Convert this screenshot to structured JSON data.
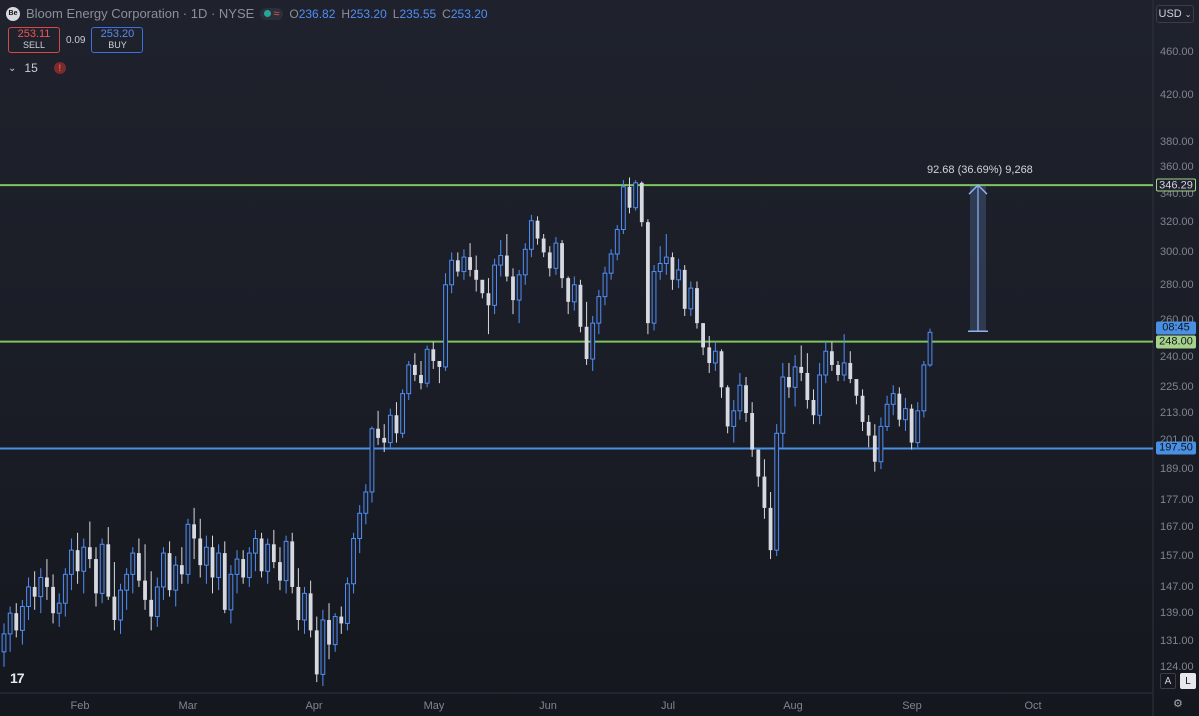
{
  "header": {
    "symbol_badge": "Be",
    "title": "Bloom Energy Corporation · 1D · NYSE",
    "ohlc": {
      "o_label": "O",
      "o": "236.82",
      "h_label": "H",
      "h": "253.20",
      "l_label": "L",
      "l": "235.55",
      "c_label": "C",
      "c": "253.20"
    },
    "sell_price": "253.11",
    "sell_label": "SELL",
    "spread": "0.09",
    "buy_price": "253.20",
    "buy_label": "BUY",
    "indicator_count": "15",
    "warning": "!"
  },
  "toolbar": {
    "currency": "USD",
    "auto_label": "A",
    "log_label": "L"
  },
  "measure_text": "92.68 (36.69%) 9,268",
  "colors": {
    "up": "#4f8ef7",
    "down": "#d7d9e0",
    "green_line": "#7ec45f",
    "blue_line": "#4a90e2"
  },
  "chart_data": {
    "type": "candlestick",
    "symbol": "Bloom Energy Corporation",
    "interval": "1D",
    "exchange": "NYSE",
    "y_scale": "log",
    "ylim": [
      118,
      480
    ],
    "y_ticks": [
      "460.00",
      "420.00",
      "380.00",
      "360.00",
      "340.00",
      "320.00",
      "300.00",
      "280.00",
      "260.00",
      "240.00",
      "225.00",
      "213.00",
      "201.00",
      "189.00",
      "177.00",
      "167.00",
      "157.00",
      "147.00",
      "139.00",
      "131.00",
      "124.00"
    ],
    "x_ticks": [
      "Feb",
      "Mar",
      "Apr",
      "May",
      "Jun",
      "Jul",
      "Aug",
      "Sep",
      "Oct"
    ],
    "horizontal_lines": [
      {
        "price": 346.29,
        "label": "346.29",
        "color": "green"
      },
      {
        "price": 248.0,
        "label": "248.00",
        "color": "green"
      },
      {
        "price": 197.5,
        "label": "197.50",
        "color": "blue"
      }
    ],
    "countdown": "08:45",
    "measure": {
      "from": 253.61,
      "to": 346.29,
      "text": "92.68 (36.69%) 9,268"
    },
    "candles": [
      [
        128,
        136,
        124,
        133
      ],
      [
        133,
        141,
        128,
        139
      ],
      [
        139,
        142,
        132,
        134
      ],
      [
        134,
        143,
        130,
        141
      ],
      [
        141,
        150,
        137,
        147
      ],
      [
        147,
        152,
        140,
        144
      ],
      [
        144,
        153,
        139,
        150
      ],
      [
        150,
        156,
        143,
        147
      ],
      [
        147,
        151,
        136,
        139
      ],
      [
        139,
        145,
        135,
        142
      ],
      [
        142,
        153,
        138,
        151
      ],
      [
        151,
        163,
        146,
        159
      ],
      [
        159,
        165,
        148,
        152
      ],
      [
        152,
        163,
        145,
        160
      ],
      [
        160,
        169,
        153,
        156
      ],
      [
        156,
        160,
        141,
        145
      ],
      [
        145,
        163,
        142,
        161
      ],
      [
        161,
        167,
        143,
        144
      ],
      [
        144,
        155,
        134,
        137
      ],
      [
        137,
        148,
        133,
        146
      ],
      [
        146,
        153,
        140,
        151
      ],
      [
        151,
        160,
        145,
        158
      ],
      [
        158,
        163,
        147,
        149
      ],
      [
        149,
        161,
        140,
        143
      ],
      [
        143,
        152,
        134,
        138
      ],
      [
        138,
        150,
        135,
        147
      ],
      [
        147,
        160,
        143,
        158
      ],
      [
        158,
        162,
        144,
        146
      ],
      [
        146,
        157,
        141,
        154
      ],
      [
        154,
        160,
        148,
        151
      ],
      [
        151,
        170,
        148,
        168
      ],
      [
        168,
        174,
        156,
        163
      ],
      [
        163,
        170,
        150,
        154
      ],
      [
        154,
        164,
        148,
        160
      ],
      [
        160,
        164,
        145,
        150
      ],
      [
        150,
        161,
        146,
        158
      ],
      [
        158,
        162,
        139,
        140
      ],
      [
        140,
        154,
        136,
        151
      ],
      [
        151,
        159,
        145,
        156
      ],
      [
        156,
        159,
        148,
        150
      ],
      [
        150,
        160,
        147,
        158
      ],
      [
        158,
        166,
        152,
        163
      ],
      [
        163,
        165,
        150,
        152
      ],
      [
        152,
        163,
        148,
        161
      ],
      [
        161,
        166,
        153,
        155
      ],
      [
        155,
        160,
        146,
        149
      ],
      [
        149,
        164,
        145,
        162
      ],
      [
        162,
        165,
        145,
        147
      ],
      [
        147,
        153,
        134,
        137
      ],
      [
        137,
        147,
        133,
        145
      ],
      [
        145,
        149,
        132,
        134
      ],
      [
        134,
        138,
        120,
        122
      ],
      [
        122,
        140,
        119,
        137
      ],
      [
        137,
        142,
        126,
        130
      ],
      [
        130,
        139,
        128,
        138
      ],
      [
        138,
        141,
        133,
        136
      ],
      [
        136,
        150,
        134,
        148
      ],
      [
        148,
        165,
        145,
        163
      ],
      [
        163,
        175,
        158,
        172
      ],
      [
        172,
        183,
        168,
        180
      ],
      [
        180,
        207,
        176,
        206
      ],
      [
        206,
        214,
        199,
        202
      ],
      [
        202,
        208,
        196,
        200
      ],
      [
        200,
        215,
        198,
        212
      ],
      [
        212,
        218,
        200,
        204
      ],
      [
        204,
        224,
        202,
        222
      ],
      [
        222,
        238,
        219,
        236
      ],
      [
        236,
        242,
        228,
        231
      ],
      [
        231,
        238,
        224,
        227
      ],
      [
        227,
        246,
        225,
        244
      ],
      [
        244,
        248,
        234,
        238
      ],
      [
        238,
        237,
        227,
        235
      ],
      [
        235,
        287,
        233,
        280
      ],
      [
        280,
        300,
        275,
        295
      ],
      [
        295,
        300,
        285,
        288
      ],
      [
        288,
        302,
        283,
        297
      ],
      [
        297,
        306,
        285,
        289
      ],
      [
        289,
        298,
        276,
        283
      ],
      [
        283,
        282,
        272,
        275
      ],
      [
        275,
        284,
        252,
        268
      ],
      [
        268,
        296,
        263,
        292
      ],
      [
        292,
        308,
        285,
        298
      ],
      [
        298,
        312,
        282,
        285
      ],
      [
        285,
        290,
        263,
        271
      ],
      [
        271,
        289,
        258,
        286
      ],
      [
        286,
        306,
        280,
        302
      ],
      [
        302,
        325,
        297,
        321
      ],
      [
        321,
        324,
        305,
        309
      ],
      [
        309,
        312,
        297,
        300
      ],
      [
        300,
        304,
        285,
        290
      ],
      [
        290,
        310,
        286,
        306
      ],
      [
        306,
        308,
        278,
        284
      ],
      [
        284,
        285,
        263,
        270
      ],
      [
        270,
        285,
        265,
        280
      ],
      [
        280,
        283,
        253,
        256
      ],
      [
        256,
        270,
        236,
        239
      ],
      [
        239,
        262,
        233,
        258
      ],
      [
        258,
        277,
        252,
        273
      ],
      [
        273,
        291,
        268,
        287
      ],
      [
        287,
        302,
        283,
        299
      ],
      [
        299,
        318,
        295,
        315
      ],
      [
        315,
        350,
        312,
        345
      ],
      [
        345,
        352,
        326,
        330
      ],
      [
        330,
        350,
        328,
        348
      ],
      [
        348,
        349,
        317,
        320
      ],
      [
        320,
        322,
        252,
        258
      ],
      [
        258,
        292,
        254,
        288
      ],
      [
        288,
        304,
        283,
        293
      ],
      [
        293,
        312,
        286,
        297
      ],
      [
        297,
        300,
        277,
        283
      ],
      [
        283,
        296,
        278,
        289
      ],
      [
        289,
        292,
        262,
        266
      ],
      [
        266,
        282,
        262,
        278
      ],
      [
        278,
        282,
        255,
        258
      ],
      [
        258,
        258,
        241,
        245
      ],
      [
        245,
        251,
        232,
        237
      ],
      [
        237,
        248,
        233,
        243
      ],
      [
        243,
        244,
        220,
        225
      ],
      [
        225,
        226,
        204,
        207
      ],
      [
        207,
        219,
        200,
        214
      ],
      [
        214,
        232,
        210,
        226
      ],
      [
        226,
        230,
        209,
        213
      ],
      [
        213,
        218,
        194,
        197
      ],
      [
        197,
        197,
        182,
        186
      ],
      [
        186,
        193,
        170,
        174
      ],
      [
        174,
        180,
        156,
        159
      ],
      [
        159,
        208,
        157,
        204
      ],
      [
        204,
        237,
        198,
        230
      ],
      [
        230,
        237,
        220,
        225
      ],
      [
        225,
        241,
        216,
        235
      ],
      [
        235,
        246,
        228,
        232
      ],
      [
        232,
        242,
        215,
        219
      ],
      [
        219,
        224,
        208,
        212
      ],
      [
        212,
        237,
        208,
        231
      ],
      [
        231,
        248,
        227,
        243
      ],
      [
        243,
        248,
        233,
        236
      ],
      [
        236,
        238,
        228,
        231
      ],
      [
        231,
        252,
        228,
        237
      ],
      [
        237,
        243,
        227,
        229
      ],
      [
        229,
        226,
        217,
        221
      ],
      [
        221,
        224,
        205,
        209
      ],
      [
        209,
        212,
        198,
        203
      ],
      [
        203,
        208,
        188,
        192
      ],
      [
        192,
        211,
        189,
        207
      ],
      [
        207,
        221,
        205,
        217
      ],
      [
        217,
        226,
        212,
        222
      ],
      [
        222,
        225,
        207,
        210
      ],
      [
        210,
        220,
        205,
        215
      ],
      [
        215,
        217,
        197,
        200
      ],
      [
        200,
        218,
        198,
        214
      ],
      [
        214,
        238,
        211,
        236
      ],
      [
        236,
        255,
        235,
        253
      ]
    ]
  }
}
